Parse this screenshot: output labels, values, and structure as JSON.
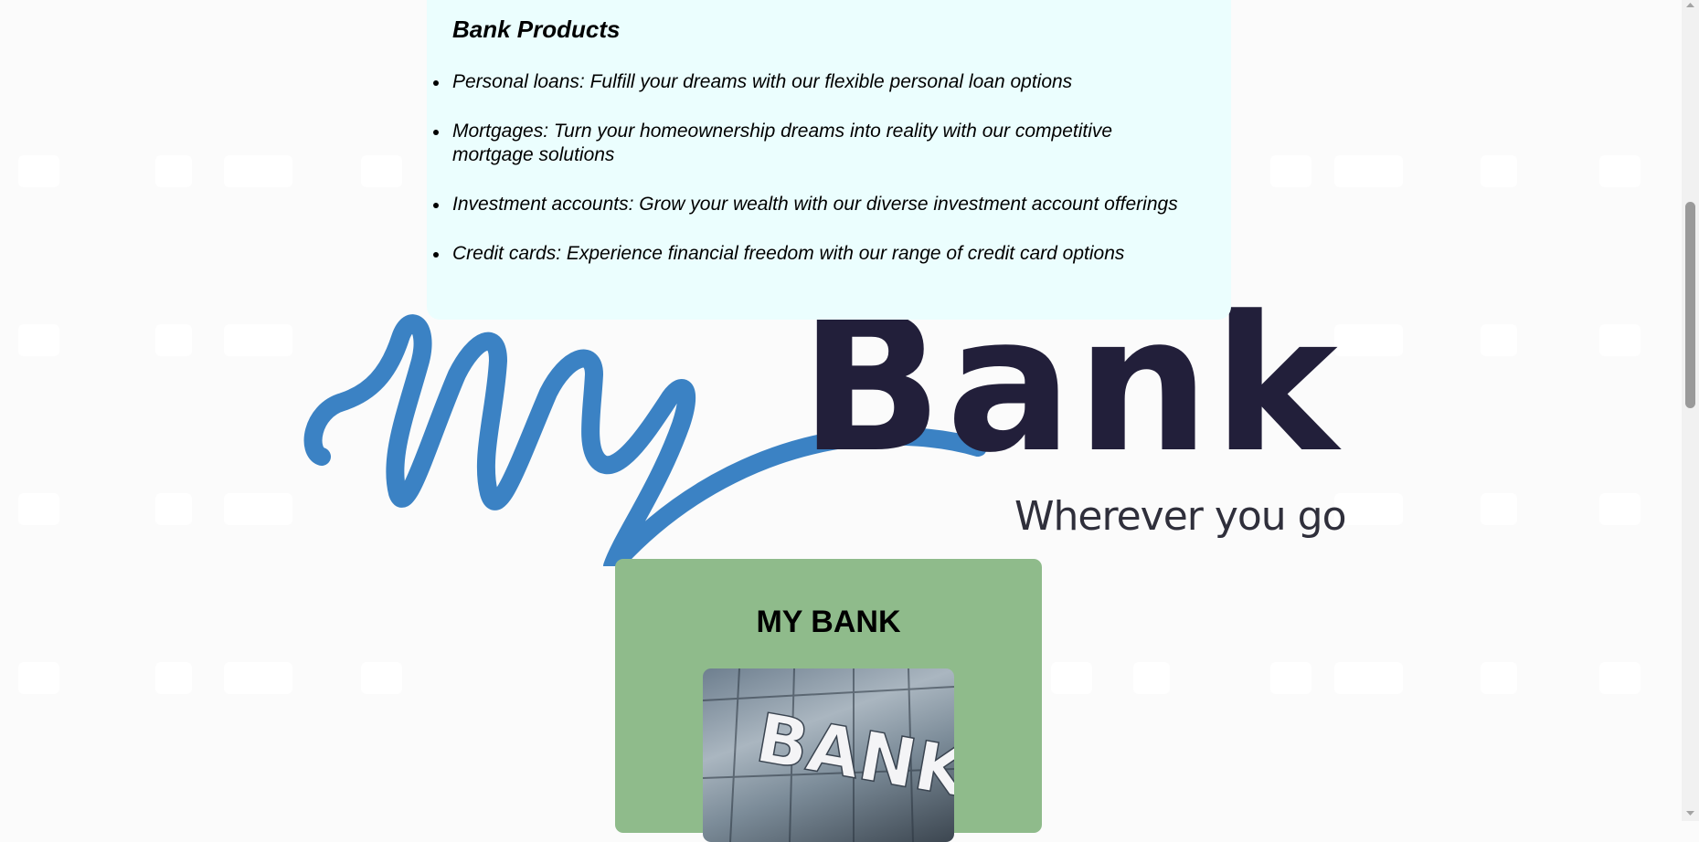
{
  "products": {
    "title": "Bank Products",
    "items": [
      "Personal loans: Fulfill your dreams with our flexible personal loan options",
      "Mortgages: Turn your homeownership dreams into reality with our competitive mortgage solutions",
      "Investment accounts: Grow your wealth with our diverse investment account offerings",
      "Credit cards: Experience financial freedom with our range of credit card options"
    ]
  },
  "logo": {
    "script_text": "My",
    "bank_text": "Bank",
    "tagline": "Wherever you go",
    "colors": {
      "script": "#3b82c4",
      "bank": "#221f3a",
      "tagline": "#2f2f3b"
    }
  },
  "card": {
    "title": "MY BANK",
    "image_text": "BANK",
    "background": "#8fbb8b"
  },
  "colors": {
    "page_bg": "#fbfbfb",
    "products_bg": "#ebfefe"
  },
  "icons": {
    "scroll_up": "caret-up-icon",
    "scroll_down": "caret-down-icon"
  }
}
